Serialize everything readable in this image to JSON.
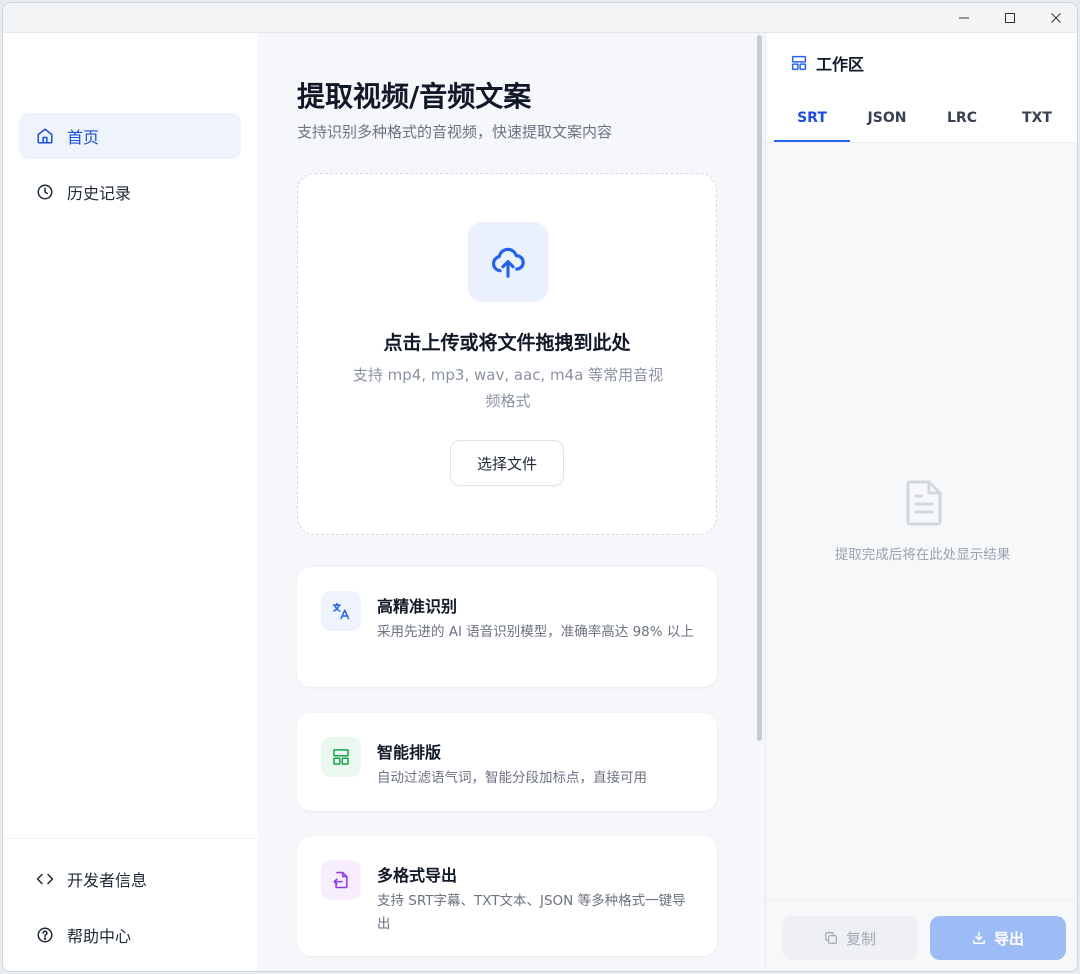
{
  "window": {
    "controls": [
      "minimize-icon",
      "maximize-icon",
      "close-icon"
    ]
  },
  "sidebar": {
    "items": [
      {
        "label": "首页",
        "icon": "home-icon",
        "active": true
      },
      {
        "label": "历史记录",
        "icon": "clock-icon",
        "active": false
      }
    ],
    "bottom_items": [
      {
        "label": "开发者信息",
        "icon": "code-icon"
      },
      {
        "label": "帮助中心",
        "icon": "help-circle-icon"
      }
    ]
  },
  "main": {
    "title": "提取视频/音频文案",
    "subtitle": "支持识别多种格式的音视频，快速提取文案内容",
    "upload": {
      "icon": "cloud-upload-icon",
      "title": "点击上传或将文件拖拽到此处",
      "description": "支持 mp4, mp3, wav, aac, m4a 等常用音视频格式",
      "button_label": "选择文件"
    },
    "features": [
      {
        "title": "高精准识别",
        "description": "采用先进的 AI 语音识别模型，准确率高达 98% 以上",
        "icon": "translate-icon",
        "color": "#2563eb"
      },
      {
        "title": "智能排版",
        "description": "自动过滤语气词，智能分段加标点，直接可用",
        "icon": "layout-icon",
        "color": "#16a34a"
      },
      {
        "title": "多格式导出",
        "description": "支持 SRT字幕、TXT文本、JSON 等多种格式一键导出",
        "icon": "file-export-icon",
        "color": "#9333ea"
      }
    ]
  },
  "workspace": {
    "title": "工作区",
    "icon": "layout-icon",
    "tabs": [
      "SRT",
      "JSON",
      "LRC",
      "TXT"
    ],
    "active_tab": "SRT",
    "empty_icon": "file-text-icon",
    "empty_text": "提取完成后将在此处显示结果",
    "copy_label": "复制",
    "export_label": "导出"
  },
  "colors": {
    "accent": "#2563eb",
    "active_nav_bg": "#eef3fc",
    "export_button": "#9dbcf5"
  }
}
